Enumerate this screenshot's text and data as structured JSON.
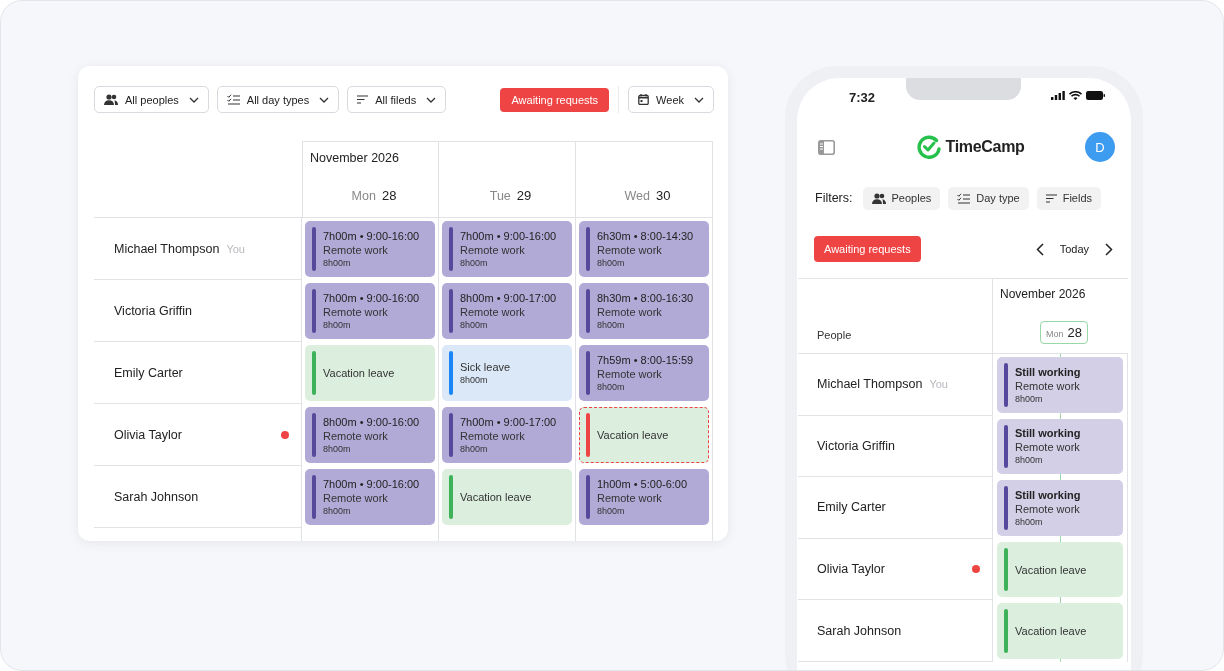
{
  "desktop": {
    "filters": [
      {
        "kind": "people",
        "label": "All peoples"
      },
      {
        "kind": "day_type",
        "label": "All day types"
      },
      {
        "kind": "fields",
        "label": "All fileds"
      }
    ],
    "awaiting_button": "Awaiting requests",
    "view": "Week",
    "month": "November 2026",
    "days": [
      {
        "weekday": "Mon",
        "date": "28"
      },
      {
        "weekday": "Tue",
        "date": "29"
      },
      {
        "weekday": "Wed",
        "date": "30"
      }
    ],
    "people": [
      {
        "name": "Michael Thompson",
        "tag": "You",
        "alert": false
      },
      {
        "name": "Victoria Griffin",
        "alert": false
      },
      {
        "name": "Emily Carter",
        "alert": false
      },
      {
        "name": "Olivia Taylor",
        "alert": true
      },
      {
        "name": "Sarah Johnson",
        "alert": false
      }
    ],
    "rows": [
      [
        {
          "kind": "work",
          "title": "7h00m • 9:00-16:00",
          "type": "Remote work",
          "hours": "8h00m",
          "pending": false
        },
        {
          "kind": "work",
          "title": "7h00m • 9:00-16:00",
          "type": "Remote work",
          "hours": "8h00m",
          "pending": false
        },
        {
          "kind": "work",
          "title": "6h30m • 8:00-14:30",
          "type": "Remote work",
          "hours": "8h00m",
          "pending": false
        }
      ],
      [
        {
          "kind": "work",
          "title": "7h00m • 9:00-16:00",
          "type": "Remote work",
          "hours": "8h00m",
          "pending": false
        },
        {
          "kind": "work",
          "title": "8h00m • 9:00-17:00",
          "type": "Remote work",
          "hours": "8h00m",
          "pending": false
        },
        {
          "kind": "work",
          "title": "8h30m • 8:00-16:30",
          "type": "Remote work",
          "hours": "8h00m",
          "pending": false
        }
      ],
      [
        {
          "kind": "vacation",
          "type": "Vacation leave",
          "pending": false
        },
        {
          "kind": "sick",
          "type": "Sick leave",
          "hours": "8h00m",
          "pending": false
        },
        {
          "kind": "work",
          "title": "7h59m • 8:00-15:59",
          "type": "Remote work",
          "hours": "8h00m",
          "pending": false
        }
      ],
      [
        {
          "kind": "work",
          "title": "8h00m • 9:00-16:00",
          "type": "Remote work",
          "hours": "8h00m",
          "pending": false
        },
        {
          "kind": "work",
          "title": "7h00m • 9:00-17:00",
          "type": "Remote work",
          "hours": "8h00m",
          "pending": false
        },
        {
          "kind": "vacation",
          "type": "Vacation leave",
          "pending": true
        }
      ],
      [
        {
          "kind": "work",
          "title": "7h00m • 9:00-16:00",
          "type": "Remote work",
          "hours": "8h00m",
          "pending": false
        },
        {
          "kind": "vacation",
          "type": "Vacation leave",
          "pending": false
        },
        {
          "kind": "work",
          "title": "1h00m • 5:00-6:00",
          "type": "Remote work",
          "hours": "8h00m",
          "pending": false
        }
      ]
    ]
  },
  "phone": {
    "time": "7:32",
    "brand": "TimeCamp",
    "avatar": "D",
    "filters_label": "Filters:",
    "filters": [
      {
        "kind": "people",
        "label": "Peoples"
      },
      {
        "kind": "day_type",
        "label": "Day type"
      },
      {
        "kind": "fields",
        "label": "Fields"
      }
    ],
    "awaiting_button": "Awaiting requests",
    "today_button": "Today",
    "people_heading": "People",
    "month": "November 2026",
    "day": {
      "weekday": "Mon",
      "date": "28",
      "selected": true
    },
    "people": [
      {
        "name": "Michael Thompson",
        "tag": "You",
        "alert": false
      },
      {
        "name": "Victoria Griffin",
        "alert": false
      },
      {
        "name": "Emily Carter",
        "alert": false
      },
      {
        "name": "Olivia Taylor",
        "alert": true
      },
      {
        "name": "Sarah Johnson",
        "alert": false
      }
    ],
    "entries": [
      {
        "kind": "ongoing",
        "title": "Still working",
        "type": "Remote work",
        "hours": "8h00m",
        "pending": false
      },
      {
        "kind": "ongoing",
        "title": "Still working",
        "type": "Remote work",
        "hours": "8h00m",
        "pending": false
      },
      {
        "kind": "ongoing",
        "title": "Still working",
        "type": "Remote work",
        "hours": "8h00m",
        "pending": false
      },
      {
        "kind": "vacation",
        "type": "Vacation leave",
        "pending": false
      },
      {
        "kind": "vacation",
        "type": "Vacation leave",
        "pending": false
      }
    ]
  }
}
